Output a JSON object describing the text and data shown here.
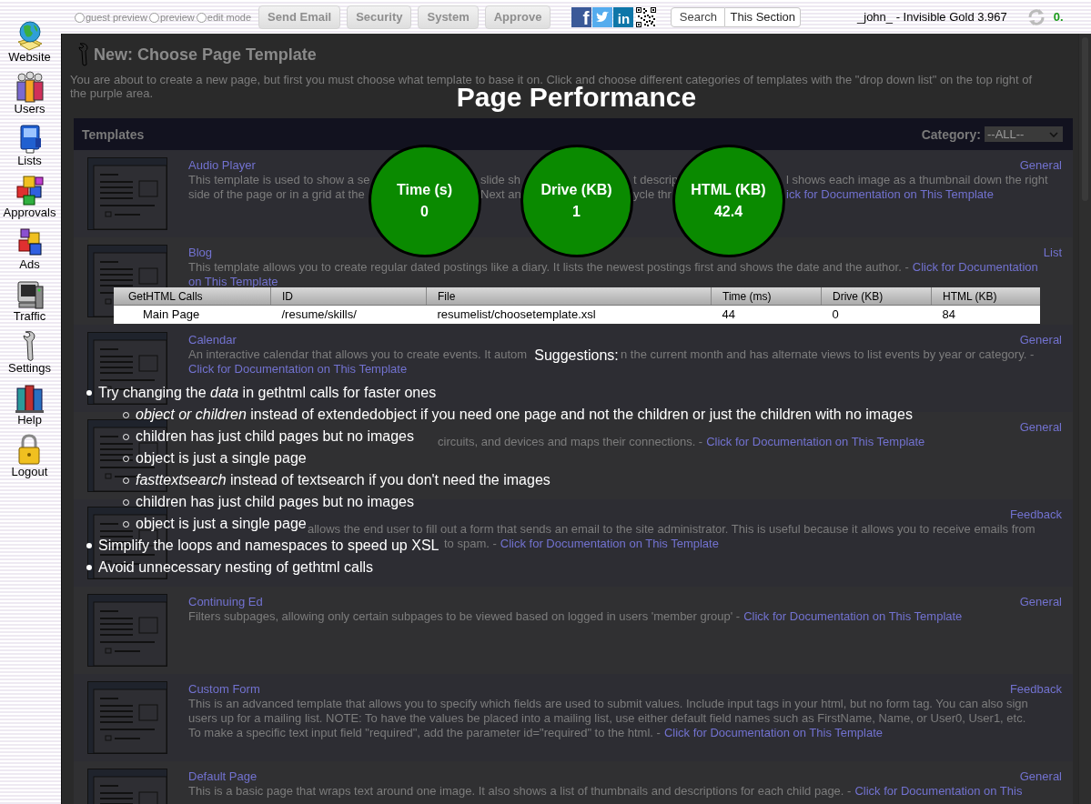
{
  "toolbar": {
    "view_modes": [
      {
        "label": "guest preview",
        "selected": false
      },
      {
        "label": "preview",
        "selected": false
      },
      {
        "label": "edit mode",
        "selected": false
      }
    ],
    "buttons": [
      {
        "label": "Send Email",
        "disabled": true
      },
      {
        "label": "Security",
        "disabled": true
      },
      {
        "label": "System",
        "disabled": true
      },
      {
        "label": "Approve",
        "disabled": true
      }
    ],
    "social": [
      {
        "kind": "facebook",
        "glyph": "f"
      },
      {
        "kind": "twitter"
      },
      {
        "kind": "linkedin",
        "glyph": "in"
      },
      {
        "kind": "qr"
      }
    ],
    "search_buttons": [
      "Search",
      "This Section"
    ],
    "user": "_john_ - Invisible Gold 3.967",
    "status": "0."
  },
  "sidebar": {
    "items": [
      {
        "label": "Website",
        "kind": "globe"
      },
      {
        "label": "Users",
        "kind": "users"
      },
      {
        "label": "Lists",
        "kind": "lists"
      },
      {
        "label": "Approvals",
        "kind": "approvals"
      },
      {
        "label": "Ads",
        "kind": "ads"
      },
      {
        "label": "Traffic",
        "kind": "traffic"
      },
      {
        "label": "Settings",
        "kind": "settings"
      },
      {
        "label": "Help",
        "kind": "help"
      },
      {
        "label": "Logout",
        "kind": "logout"
      }
    ]
  },
  "page": {
    "title": "New: Choose Page Template",
    "intro": [
      "You are about to create a new page, but first you must choose what template to base it on. Click and choose different categories of templates with the \"drop down list\" on the top right of",
      "the purple area."
    ],
    "templates": {
      "header": "Templates",
      "category_label": "Category:",
      "category_value": "--ALL--",
      "rows": [
        {
          "title": "Audio Player",
          "category": "General",
          "lines": [
            [
              {
                "text": "This template is used to show a se",
                "link": false
              },
              {
                "text": "slide sh",
                "link": false
              },
              {
                "text": "t descrip",
                "link": false
              },
              {
                "text": "l shows each image as a thumbnail down the right",
                "link": false
              }
            ],
            [
              {
                "text": "side of the page or in a grid at the",
                "link": false
              },
              {
                "text": "Next an",
                "link": false
              },
              {
                "text": "ycle thr",
                "link": false
              },
              {
                "text": "ick for Documentation on This Template",
                "link": true
              }
            ]
          ]
        },
        {
          "title": "Blog",
          "category": "List",
          "lines": [
            [
              {
                "text": "This template allows you to create regular dated postings like a diary. It lists the newest postings first and shows the date and the author. -",
                "link": false
              },
              {
                "text": "Click for Documentation",
                "link": true
              }
            ],
            [
              {
                "text": "on This Template",
                "link": true
              }
            ]
          ]
        },
        {
          "title": "Calendar",
          "category": "General",
          "lines": [
            [
              {
                "text": "An interactive calendar that allows you to create events. It autom",
                "link": false
              },
              {
                "text": "n the current month and has alternate views to list events by year or category. -",
                "link": false
              }
            ],
            [
              {
                "text": "Click for Documentation on This Template",
                "link": true
              }
            ]
          ]
        },
        {
          "category": "General",
          "lines": [
            [
              {
                "text": "circuits, and devices and maps their connections. -",
                "link": false
              },
              {
                "text": "Click for Documentation on This Template",
                "link": true
              }
            ]
          ]
        },
        {
          "category": "Feedback",
          "lines": [
            [
              {
                "text": "allows the end user to fill out a form that sends an email to the site administrator. This is useful because it allows you to receive emails from",
                "link": false
              }
            ],
            [
              {
                "text": "to spam. -",
                "link": false
              },
              {
                "text": "Click for Documentation on This Template",
                "link": true
              }
            ]
          ]
        },
        {
          "title": "Continuing Ed",
          "category": "General",
          "lines": [
            [
              {
                "text": "Filters subpages, allowing only certain subpages to be viewed based on logged in users 'member group' -",
                "link": false
              },
              {
                "text": "Click for Documentation on This Template",
                "link": true
              }
            ]
          ]
        },
        {
          "title": "Custom Form",
          "category": "Feedback",
          "lines": [
            [
              {
                "text": "This is an advanced template that allows you to specify which fields are used to submit values. Include input tags in your html, but no form tag. You can also sign",
                "link": false
              }
            ],
            [
              {
                "text": "users up for a mailing list. NOTE: To have the values be placed into a mailing list, use either default field names such as FirstName, Name, or User0, User1, etc.",
                "link": false
              }
            ],
            [
              {
                "text": "To make a specific text input field \"required\", add the parameter id=\"required\" to the html. -",
                "link": false
              },
              {
                "text": "Click for Documentation on This Template",
                "link": true
              }
            ]
          ]
        },
        {
          "title": "Default Page",
          "category": "General",
          "lines": [
            [
              {
                "text": "This is a basic page that wraps text around one image. It also shows a list of thumbnails and descriptions for each child page. -",
                "link": false
              },
              {
                "text": "Click for Documentation on This",
                "link": true
              }
            ]
          ]
        }
      ]
    }
  },
  "performance": {
    "title": "Page Performance",
    "metrics": [
      {
        "label": "Time (s)",
        "value": "0"
      },
      {
        "label": "Drive (KB)",
        "value": "1"
      },
      {
        "label": "HTML (KB)",
        "value": "42.4"
      }
    ],
    "table": {
      "columns": [
        "GetHTML Calls",
        "ID",
        "File",
        "Time (ms)",
        "Drive (KB)",
        "HTML (KB)"
      ],
      "rows": [
        [
          "Main Page",
          "/resume/skills/",
          "resumelist/choosetemplate.xsl",
          "44",
          "0",
          "84"
        ]
      ]
    },
    "suggestions_title": "Suggestions:",
    "suggestions": [
      {
        "text": "Try changing the *data* in gethtml calls for faster ones",
        "children": [
          {
            "text": "*object or children* instead of extendedobject if you need one page and not the children or just the children with no images"
          },
          {
            "text": "children has just child pages but no images"
          },
          {
            "text": "object is just a single page"
          },
          {
            "text": "*fasttextsearch* instead of textsearch if you don't need the images"
          },
          {
            "text": "children has just child pages but no images"
          },
          {
            "text": "object is just a single page"
          }
        ]
      },
      {
        "text": "Simplify the loops and namespaces to speed up XSL"
      },
      {
        "text": "Avoid unnecessary nesting of gethtml calls"
      }
    ]
  }
}
